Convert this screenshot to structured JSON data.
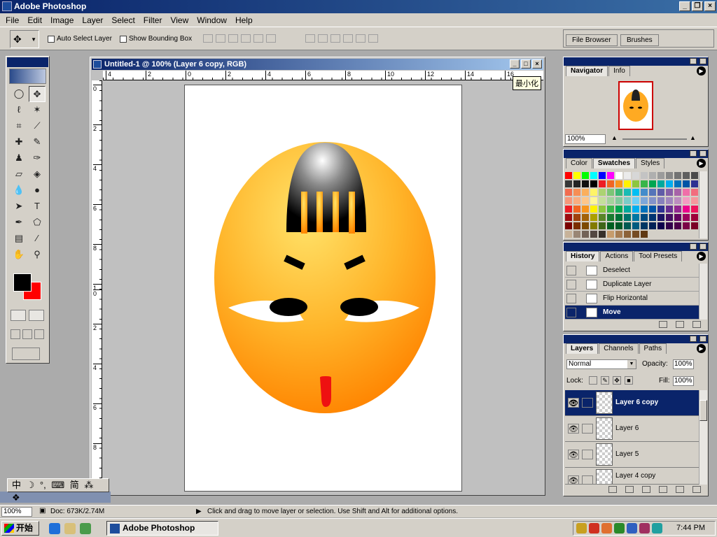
{
  "app": {
    "title": "Adobe Photoshop"
  },
  "menu": [
    "File",
    "Edit",
    "Image",
    "Layer",
    "Select",
    "Filter",
    "View",
    "Window",
    "Help"
  ],
  "options": {
    "auto_select": "Auto Select Layer",
    "show_bounding": "Show Bounding Box"
  },
  "well_tabs": [
    "File Browser",
    "Brushes"
  ],
  "document": {
    "title": "Untitled-1 @ 100% (Layer 6 copy, RGB)",
    "tooltip": "最小化",
    "ruler_h": [
      "4",
      "2",
      "0",
      "2",
      "4",
      "6",
      "8",
      "10",
      "12",
      "14",
      "16"
    ],
    "ruler_v": [
      "0",
      "2",
      "4",
      "6",
      "8",
      "1",
      "0",
      "2",
      "4",
      "6",
      "8"
    ]
  },
  "navigator": {
    "tabs": [
      "Navigator",
      "Info"
    ],
    "zoom": "100%"
  },
  "swatches": {
    "tabs": [
      "Color",
      "Swatches",
      "Styles"
    ],
    "colors": [
      "#ff0000",
      "#ffff00",
      "#00ff00",
      "#00ffff",
      "#0000ff",
      "#ff00ff",
      "#ffffff",
      "#ebebeb",
      "#d7d7d7",
      "#c3c3c3",
      "#afafaf",
      "#9b9b9b",
      "#878787",
      "#737373",
      "#5f5f5f",
      "#4b4b4b",
      "#373737",
      "#232323",
      "#0f0f0f",
      "#000000",
      "#ee1d24",
      "#f16522",
      "#f7941d",
      "#fff200",
      "#8dc63f",
      "#39b54a",
      "#00a651",
      "#00a99d",
      "#00aeef",
      "#0072bc",
      "#0054a6",
      "#2e3192",
      "#f26c4f",
      "#f68e55",
      "#fbaf5c",
      "#fff467",
      "#acd372",
      "#7cc576",
      "#3bb878",
      "#1abbb4",
      "#00bff3",
      "#438ccb",
      "#5574b9",
      "#605ca8",
      "#855fa8",
      "#a763a8",
      "#f06ea9",
      "#f26d7d",
      "#f7977a",
      "#f9ad81",
      "#fdc68a",
      "#fff799",
      "#c4df9b",
      "#a3d39c",
      "#82ca9c",
      "#7accc8",
      "#6dcff6",
      "#7da7d9",
      "#8393ca",
      "#8781bd",
      "#a187be",
      "#bc8dbf",
      "#f49ac2",
      "#f5989d",
      "#ed1c24",
      "#f26522",
      "#f7941d",
      "#fff200",
      "#8dc63f",
      "#39b54a",
      "#00a651",
      "#00a99d",
      "#00aeef",
      "#0072bc",
      "#0054a6",
      "#2e3192",
      "#662d91",
      "#92278f",
      "#ec008c",
      "#ed145b",
      "#9e0b0f",
      "#a0410d",
      "#a36209",
      "#aba000",
      "#598527",
      "#197b30",
      "#007236",
      "#00746b",
      "#0076a3",
      "#004a80",
      "#003471",
      "#1b1464",
      "#440e62",
      "#630460",
      "#9e005d",
      "#9e0039",
      "#790000",
      "#7b2e00",
      "#7d4900",
      "#827b00",
      "#406618",
      "#005e20",
      "#005826",
      "#005952",
      "#005b7f",
      "#003663",
      "#002157",
      "#0d004c",
      "#32004b",
      "#4b0049",
      "#7b0046",
      "#7a0026",
      "#c7b299",
      "#998675",
      "#736357",
      "#534741",
      "#37302a",
      "#c69c6d",
      "#a67c52",
      "#8c6239",
      "#754c24",
      "#603913"
    ]
  },
  "history": {
    "tabs": [
      "History",
      "Actions",
      "Tool Presets"
    ],
    "items": [
      "Deselect",
      "Duplicate Layer",
      "Flip Horizontal",
      "Move"
    ]
  },
  "layers": {
    "tabs": [
      "Layers",
      "Channels",
      "Paths"
    ],
    "blend": "Normal",
    "opacity_label": "Opacity:",
    "opacity": "100%",
    "lock_label": "Lock:",
    "fill_label": "Fill:",
    "fill": "100%",
    "items": [
      "Layer 6 copy",
      "Layer 6",
      "Layer 5",
      "Layer 4 copy"
    ]
  },
  "ime": [
    "中",
    "☽",
    "°,",
    "⌨",
    "简",
    "⁂",
    "❖"
  ],
  "status": {
    "zoom": "100%",
    "doc": "Doc: 673K/2.74M",
    "hint": "Click and drag to move layer or selection.  Use Shift and Alt for additional options."
  },
  "taskbar": {
    "start": "开始",
    "task": "Adobe Photoshop",
    "clock": "7:44 PM"
  },
  "colors": {
    "title_blue": "#0a246a",
    "face_yellow": "#ffe066",
    "face_orange": "#ff8a00",
    "tongue_red": "#ee1111",
    "foreground": "#000000",
    "background": "#ff0000"
  }
}
